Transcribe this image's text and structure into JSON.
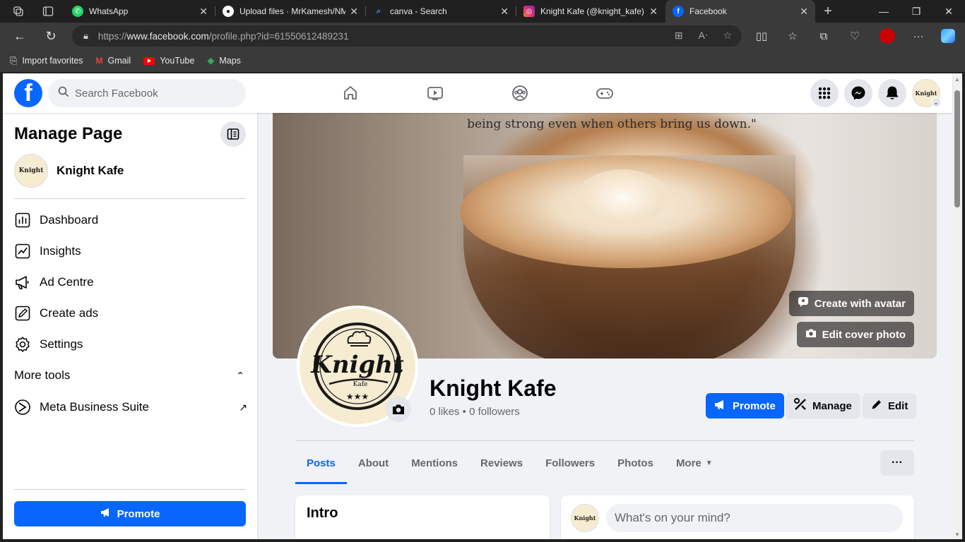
{
  "browser": {
    "tabs": [
      {
        "title": "WhatsApp",
        "favicon": "whatsapp-icon",
        "color": "#25d366"
      },
      {
        "title": "Upload files · MrKamesh/NM",
        "favicon": "github-icon",
        "color": "#ffffff"
      },
      {
        "title": "canva - Search",
        "favicon": "search-icon",
        "color": "#4a90e2"
      },
      {
        "title": "Knight Kafe (@knight_kafe)",
        "favicon": "instagram-icon",
        "color": "#e1306c"
      },
      {
        "title": "Facebook",
        "favicon": "facebook-icon",
        "color": "#0866ff"
      }
    ],
    "url_prefix": "https://",
    "url_domain": "www.facebook.com",
    "url_path": "/profile.php?id=61550612489231",
    "favorites": [
      {
        "label": "Import favorites",
        "icon": "import-icon"
      },
      {
        "label": "Gmail",
        "icon": "gmail-icon"
      },
      {
        "label": "YouTube",
        "icon": "youtube-icon"
      },
      {
        "label": "Maps",
        "icon": "maps-icon"
      }
    ]
  },
  "fb": {
    "search_placeholder": "Search Facebook",
    "manage": {
      "title": "Manage Page",
      "page_name": "Knight Kafe",
      "items": [
        {
          "label": "Dashboard",
          "icon": "dashboard-icon"
        },
        {
          "label": "Insights",
          "icon": "insights-icon"
        },
        {
          "label": "Ad Centre",
          "icon": "megaphone-icon"
        },
        {
          "label": "Create ads",
          "icon": "pencil-icon"
        },
        {
          "label": "Settings",
          "icon": "gear-icon"
        }
      ],
      "more_tools": "More tools",
      "meta_suite": "Meta Business Suite",
      "promote": "Promote"
    },
    "cover": {
      "quote": "being strong even when others bring us down.\"",
      "create_avatar": "Create with avatar",
      "edit_cover": "Edit cover photo"
    },
    "profile": {
      "name": "Knight Kafe",
      "stats": "0 likes • 0 followers",
      "logo_text": "Knight",
      "logo_sub": "Kafe"
    },
    "actions": {
      "promote": "Promote",
      "manage": "Manage",
      "edit": "Edit"
    },
    "tabs": [
      "Posts",
      "About",
      "Mentions",
      "Reviews",
      "Followers",
      "Photos",
      "More"
    ],
    "more_dots": "···",
    "intro_title": "Intro",
    "composer_placeholder": "What's on your mind?"
  }
}
